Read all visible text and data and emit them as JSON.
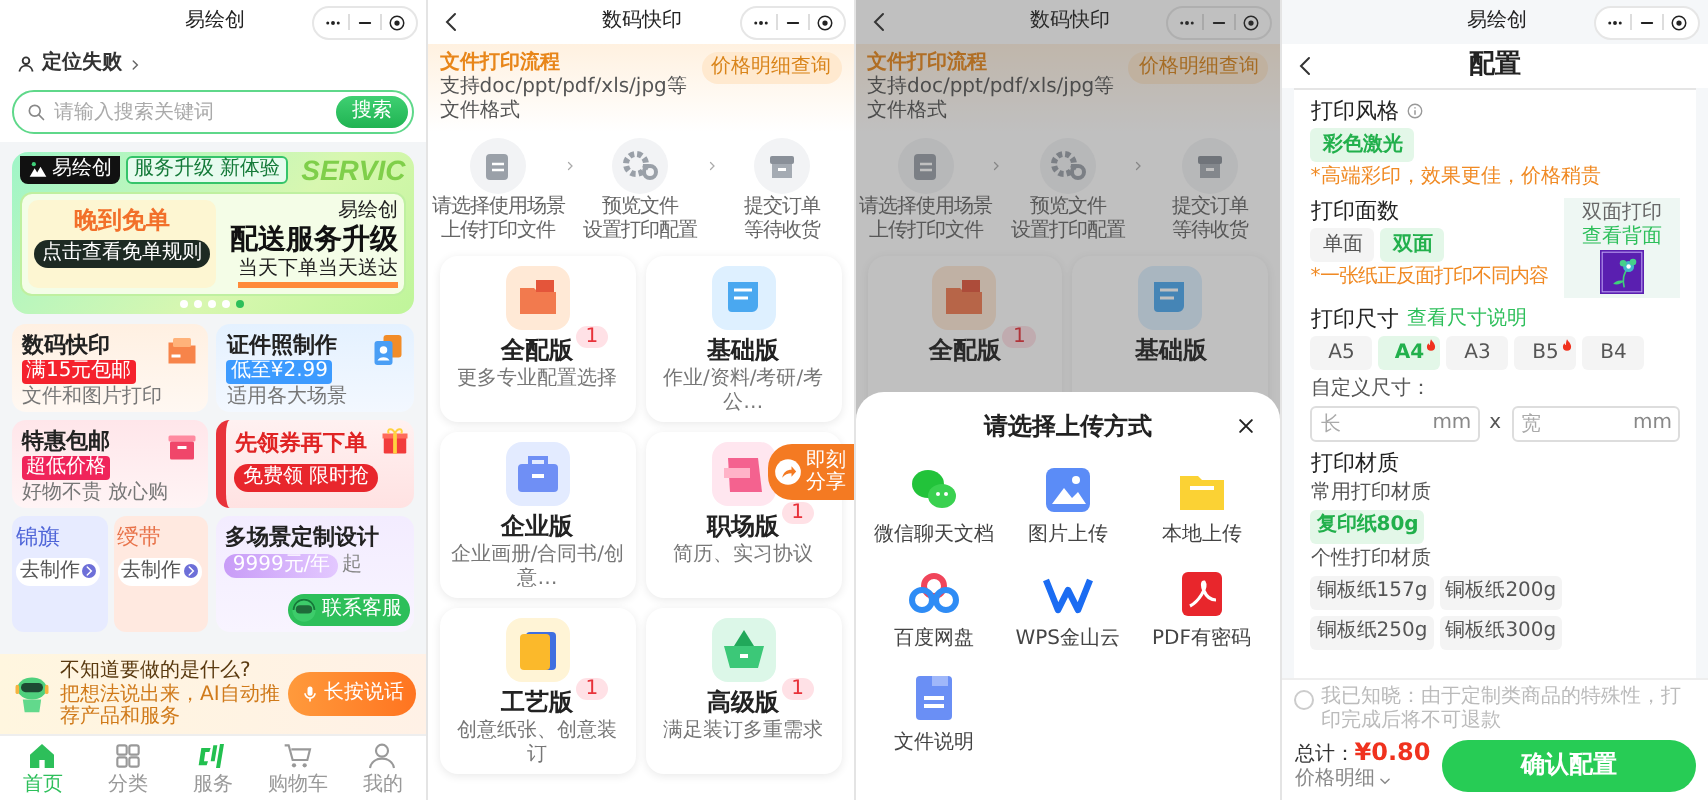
{
  "home": {
    "title": "易绘创",
    "location": "定位失败",
    "search": {
      "placeholder": "请输入搜索关键词",
      "button": "搜索"
    },
    "banner": {
      "brand": "易绘创",
      "tag": "服务升级 新体验",
      "bg_text": "SERVIC",
      "promo": "晚到免单",
      "promo_button": "点击查看免单规则",
      "brand_2": "易绘创",
      "headline": "配送服务升级",
      "subline": "当天下单当天送达",
      "dots": [
        {
          "selected": false
        },
        {
          "selected": false
        },
        {
          "selected": false
        },
        {
          "selected": false
        },
        {
          "selected": true
        }
      ]
    },
    "cards": [
      {
        "title": "数码快印",
        "badge": "满15元包邮",
        "subtitle": "文件和图片打印"
      },
      {
        "title": "证件照制作",
        "badge": "低至¥2.99",
        "subtitle": "适用各大场景"
      },
      {
        "title": "特惠包邮",
        "badge": "超低价格",
        "subtitle": "好物不贵 放心购"
      }
    ],
    "coupon": {
      "title": "先领券再下单",
      "button": "免费领 限时抢"
    },
    "mini_cards": [
      {
        "title": "锦旗",
        "button": "去制作"
      },
      {
        "title": "绶带",
        "button": "去制作"
      }
    ],
    "custom": {
      "title": "多场景定制设计",
      "price": "9999元/年",
      "suffix": "起"
    },
    "service": "联系客服",
    "assistant": {
      "question": "不知道要做的是什么?",
      "hint": "把想法说出来，AI自动推荐产品和服务",
      "button": "长按说话"
    },
    "tabs": [
      {
        "label": "首页",
        "selected": true
      },
      {
        "label": "分类",
        "selected": false
      },
      {
        "label": "服务",
        "selected": false
      },
      {
        "label": "购物车",
        "selected": false
      },
      {
        "label": "我的",
        "selected": false
      }
    ]
  },
  "print": {
    "title": "数码快印",
    "header": {
      "title": "文件打印流程",
      "subtitle": "支持doc/ppt/pdf/xls/jpg等文件格式",
      "button": "价格明细查询"
    },
    "steps": [
      {
        "title": "请选择使用场景",
        "detail": "上传打印文件"
      },
      {
        "title": "预览文件",
        "detail": "设置打印配置"
      },
      {
        "title": "提交订单",
        "detail": "等待收货"
      }
    ],
    "products": [
      {
        "title": "全配版",
        "subtitle": "更多专业配置选择",
        "badge": "1"
      },
      {
        "title": "基础版",
        "subtitle": "作业/资料/考研/考公…"
      },
      {
        "title": "企业版",
        "subtitle": "企业画册/合同书/创意…"
      },
      {
        "title": "职场版",
        "subtitle": "简历、实习协议",
        "badge": "1"
      },
      {
        "title": "工艺版",
        "subtitle": "创意纸张、创意装订",
        "badge": "1"
      },
      {
        "title": "高级版",
        "subtitle": "满足装订多重需求",
        "badge": "1"
      }
    ],
    "share": "即刻分享"
  },
  "upload": {
    "title": "数码快印",
    "header": {
      "title": "文件打印流程",
      "subtitle": "支持doc/ppt/pdf/xls/jpg等文件格式",
      "button": "价格明细查询"
    },
    "steps": [
      {
        "title": "请选择使用场景",
        "detail": "上传打印文件"
      },
      {
        "title": "预览文件",
        "detail": "设置打印配置"
      },
      {
        "title": "提交订单",
        "detail": "等待收货"
      }
    ],
    "products": [
      {
        "title": "全配版",
        "badge": "1"
      },
      {
        "title": "基础版"
      }
    ],
    "sheet": {
      "title": "请选择上传方式",
      "options": [
        "微信聊天文档",
        "图片上传",
        "本地上传",
        "百度网盘",
        "WPS金山云",
        "PDF有密码",
        "文件说明"
      ]
    }
  },
  "config": {
    "title": "易绘创",
    "heading": "配置",
    "style": {
      "label": "打印风格",
      "options": [
        {
          "label": "彩色激光",
          "selected": true
        }
      ],
      "note": "*高端彩印，效果更佳，价格稍贵"
    },
    "sides": {
      "label": "打印面数",
      "options": [
        {
          "label": "单面",
          "selected": false
        },
        {
          "label": "双面",
          "selected": true
        }
      ],
      "note": "*一张纸正反面打印不同内容",
      "preview_label": "双面打印",
      "preview_link": "查看背面"
    },
    "size": {
      "label": "打印尺寸",
      "link": "查看尺寸说明",
      "options": [
        {
          "label": "A5",
          "selected": false,
          "hot": false
        },
        {
          "label": "A4",
          "selected": true,
          "hot": true
        },
        {
          "label": "A3",
          "selected": false,
          "hot": false
        },
        {
          "label": "B5",
          "selected": false,
          "hot": true
        },
        {
          "label": "B4",
          "selected": false,
          "hot": false
        }
      ]
    },
    "custom_size": {
      "label": "自定义尺寸：",
      "length_placeholder": "长",
      "length_unit": "mm",
      "separator": "x",
      "width_placeholder": "宽",
      "width_unit": "mm"
    },
    "material": {
      "label": "打印材质",
      "common_label": "常用打印材质",
      "common": [
        {
          "label": "复印纸80g",
          "selected": true
        }
      ],
      "custom_label": "个性打印材质",
      "custom": [
        {
          "label": "铜板纸157g",
          "selected": false
        },
        {
          "label": "铜板纸200g",
          "selected": false
        },
        {
          "label": "铜板纸250g",
          "selected": false
        },
        {
          "label": "铜板纸300g",
          "selected": false
        }
      ]
    },
    "agreement": {
      "text": "我已知晓：由于定制类商品的特殊性，打印完成后将不可退款",
      "checked": false
    },
    "total_label": "总计：",
    "total": "¥0.80",
    "details": "价格明细",
    "confirm": "确认配置"
  }
}
